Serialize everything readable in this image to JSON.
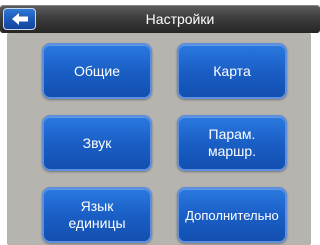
{
  "header": {
    "title": "Настройки",
    "back_icon": "back-arrow-icon"
  },
  "menu": {
    "general": "Общие",
    "map": "Карта",
    "sound": "Звук",
    "route_params": "Парам.\nмаршр.",
    "language_units": "Язык\nединицы",
    "advanced": "Дополнительно"
  },
  "colors": {
    "button_blue": "#1a5fc6",
    "panel_gray": "#b6b4ae",
    "header_dark": "#3d3d3d"
  }
}
